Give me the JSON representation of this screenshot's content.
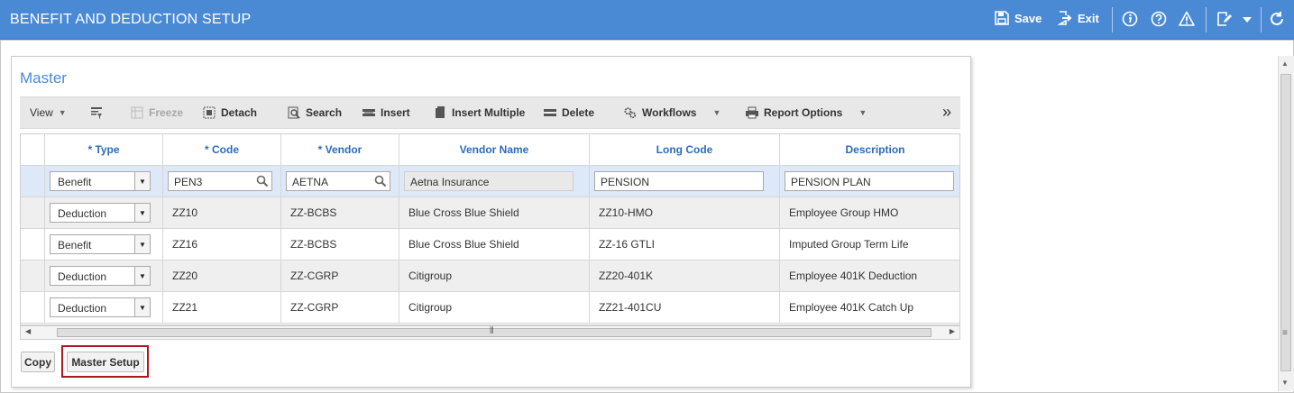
{
  "header": {
    "title": "BENEFIT AND DEDUCTION SETUP",
    "save_label": "Save",
    "exit_label": "Exit"
  },
  "master": {
    "title": "Master",
    "toolbar": {
      "view": "View",
      "freeze": "Freeze",
      "detach": "Detach",
      "search": "Search",
      "insert": "Insert",
      "insert_multiple": "Insert Multiple",
      "delete": "Delete",
      "workflows": "Workflows",
      "report_options": "Report Options",
      "more": "»"
    },
    "columns": [
      "* Type",
      "* Code",
      "* Vendor",
      "Vendor Name",
      "Long Code",
      "Description"
    ],
    "rows": [
      {
        "type": "Benefit",
        "code": "PEN3",
        "vendor": "AETNA",
        "vendor_name": "Aetna Insurance",
        "long_code": "PENSION",
        "description": "PENSION PLAN"
      },
      {
        "type": "Deduction",
        "code": "ZZ10",
        "vendor": "ZZ-BCBS",
        "vendor_name": "Blue Cross Blue Shield",
        "long_code": "ZZ10-HMO",
        "description": "Employee Group HMO"
      },
      {
        "type": "Benefit",
        "code": "ZZ16",
        "vendor": "ZZ-BCBS",
        "vendor_name": "Blue Cross Blue Shield",
        "long_code": "ZZ-16 GTLI",
        "description": "Imputed Group Term Life"
      },
      {
        "type": "Deduction",
        "code": "ZZ20",
        "vendor": "ZZ-CGRP",
        "vendor_name": "Citigroup",
        "long_code": "ZZ20-401K",
        "description": "Employee 401K Deduction"
      },
      {
        "type": "Deduction",
        "code": "ZZ21",
        "vendor": "ZZ-CGRP",
        "vendor_name": "Citigroup",
        "long_code": "ZZ21-401CU",
        "description": "Employee 401K Catch Up"
      }
    ],
    "buttons": {
      "copy": "Copy",
      "master_setup": "Master Setup"
    }
  },
  "colors": {
    "header_bg": "#4a8ad4",
    "title_blue": "#4a8ad4",
    "column_header": "#2b6cb8",
    "selected_row": "#dde9f8",
    "highlight_border": "#b0151f"
  }
}
